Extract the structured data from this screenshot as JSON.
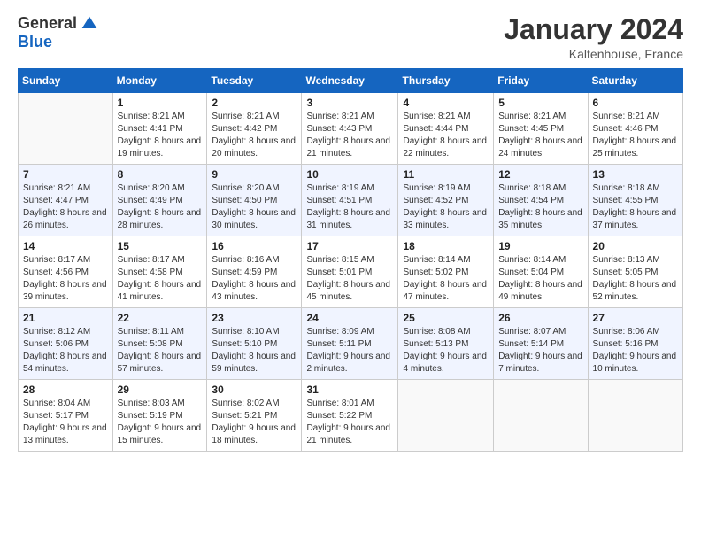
{
  "logo": {
    "general": "General",
    "blue": "Blue"
  },
  "header": {
    "month": "January 2024",
    "location": "Kaltenhouse, France"
  },
  "days_of_week": [
    "Sunday",
    "Monday",
    "Tuesday",
    "Wednesday",
    "Thursday",
    "Friday",
    "Saturday"
  ],
  "weeks": [
    [
      {
        "num": "",
        "sunrise": "",
        "sunset": "",
        "daylight": "",
        "empty": true
      },
      {
        "num": "1",
        "sunrise": "Sunrise: 8:21 AM",
        "sunset": "Sunset: 4:41 PM",
        "daylight": "Daylight: 8 hours and 19 minutes."
      },
      {
        "num": "2",
        "sunrise": "Sunrise: 8:21 AM",
        "sunset": "Sunset: 4:42 PM",
        "daylight": "Daylight: 8 hours and 20 minutes."
      },
      {
        "num": "3",
        "sunrise": "Sunrise: 8:21 AM",
        "sunset": "Sunset: 4:43 PM",
        "daylight": "Daylight: 8 hours and 21 minutes."
      },
      {
        "num": "4",
        "sunrise": "Sunrise: 8:21 AM",
        "sunset": "Sunset: 4:44 PM",
        "daylight": "Daylight: 8 hours and 22 minutes."
      },
      {
        "num": "5",
        "sunrise": "Sunrise: 8:21 AM",
        "sunset": "Sunset: 4:45 PM",
        "daylight": "Daylight: 8 hours and 24 minutes."
      },
      {
        "num": "6",
        "sunrise": "Sunrise: 8:21 AM",
        "sunset": "Sunset: 4:46 PM",
        "daylight": "Daylight: 8 hours and 25 minutes."
      }
    ],
    [
      {
        "num": "7",
        "sunrise": "Sunrise: 8:21 AM",
        "sunset": "Sunset: 4:47 PM",
        "daylight": "Daylight: 8 hours and 26 minutes."
      },
      {
        "num": "8",
        "sunrise": "Sunrise: 8:20 AM",
        "sunset": "Sunset: 4:49 PM",
        "daylight": "Daylight: 8 hours and 28 minutes."
      },
      {
        "num": "9",
        "sunrise": "Sunrise: 8:20 AM",
        "sunset": "Sunset: 4:50 PM",
        "daylight": "Daylight: 8 hours and 30 minutes."
      },
      {
        "num": "10",
        "sunrise": "Sunrise: 8:19 AM",
        "sunset": "Sunset: 4:51 PM",
        "daylight": "Daylight: 8 hours and 31 minutes."
      },
      {
        "num": "11",
        "sunrise": "Sunrise: 8:19 AM",
        "sunset": "Sunset: 4:52 PM",
        "daylight": "Daylight: 8 hours and 33 minutes."
      },
      {
        "num": "12",
        "sunrise": "Sunrise: 8:18 AM",
        "sunset": "Sunset: 4:54 PM",
        "daylight": "Daylight: 8 hours and 35 minutes."
      },
      {
        "num": "13",
        "sunrise": "Sunrise: 8:18 AM",
        "sunset": "Sunset: 4:55 PM",
        "daylight": "Daylight: 8 hours and 37 minutes."
      }
    ],
    [
      {
        "num": "14",
        "sunrise": "Sunrise: 8:17 AM",
        "sunset": "Sunset: 4:56 PM",
        "daylight": "Daylight: 8 hours and 39 minutes."
      },
      {
        "num": "15",
        "sunrise": "Sunrise: 8:17 AM",
        "sunset": "Sunset: 4:58 PM",
        "daylight": "Daylight: 8 hours and 41 minutes."
      },
      {
        "num": "16",
        "sunrise": "Sunrise: 8:16 AM",
        "sunset": "Sunset: 4:59 PM",
        "daylight": "Daylight: 8 hours and 43 minutes."
      },
      {
        "num": "17",
        "sunrise": "Sunrise: 8:15 AM",
        "sunset": "Sunset: 5:01 PM",
        "daylight": "Daylight: 8 hours and 45 minutes."
      },
      {
        "num": "18",
        "sunrise": "Sunrise: 8:14 AM",
        "sunset": "Sunset: 5:02 PM",
        "daylight": "Daylight: 8 hours and 47 minutes."
      },
      {
        "num": "19",
        "sunrise": "Sunrise: 8:14 AM",
        "sunset": "Sunset: 5:04 PM",
        "daylight": "Daylight: 8 hours and 49 minutes."
      },
      {
        "num": "20",
        "sunrise": "Sunrise: 8:13 AM",
        "sunset": "Sunset: 5:05 PM",
        "daylight": "Daylight: 8 hours and 52 minutes."
      }
    ],
    [
      {
        "num": "21",
        "sunrise": "Sunrise: 8:12 AM",
        "sunset": "Sunset: 5:06 PM",
        "daylight": "Daylight: 8 hours and 54 minutes."
      },
      {
        "num": "22",
        "sunrise": "Sunrise: 8:11 AM",
        "sunset": "Sunset: 5:08 PM",
        "daylight": "Daylight: 8 hours and 57 minutes."
      },
      {
        "num": "23",
        "sunrise": "Sunrise: 8:10 AM",
        "sunset": "Sunset: 5:10 PM",
        "daylight": "Daylight: 8 hours and 59 minutes."
      },
      {
        "num": "24",
        "sunrise": "Sunrise: 8:09 AM",
        "sunset": "Sunset: 5:11 PM",
        "daylight": "Daylight: 9 hours and 2 minutes."
      },
      {
        "num": "25",
        "sunrise": "Sunrise: 8:08 AM",
        "sunset": "Sunset: 5:13 PM",
        "daylight": "Daylight: 9 hours and 4 minutes."
      },
      {
        "num": "26",
        "sunrise": "Sunrise: 8:07 AM",
        "sunset": "Sunset: 5:14 PM",
        "daylight": "Daylight: 9 hours and 7 minutes."
      },
      {
        "num": "27",
        "sunrise": "Sunrise: 8:06 AM",
        "sunset": "Sunset: 5:16 PM",
        "daylight": "Daylight: 9 hours and 10 minutes."
      }
    ],
    [
      {
        "num": "28",
        "sunrise": "Sunrise: 8:04 AM",
        "sunset": "Sunset: 5:17 PM",
        "daylight": "Daylight: 9 hours and 13 minutes."
      },
      {
        "num": "29",
        "sunrise": "Sunrise: 8:03 AM",
        "sunset": "Sunset: 5:19 PM",
        "daylight": "Daylight: 9 hours and 15 minutes."
      },
      {
        "num": "30",
        "sunrise": "Sunrise: 8:02 AM",
        "sunset": "Sunset: 5:21 PM",
        "daylight": "Daylight: 9 hours and 18 minutes."
      },
      {
        "num": "31",
        "sunrise": "Sunrise: 8:01 AM",
        "sunset": "Sunset: 5:22 PM",
        "daylight": "Daylight: 9 hours and 21 minutes."
      },
      {
        "num": "",
        "sunrise": "",
        "sunset": "",
        "daylight": "",
        "empty": true
      },
      {
        "num": "",
        "sunrise": "",
        "sunset": "",
        "daylight": "",
        "empty": true
      },
      {
        "num": "",
        "sunrise": "",
        "sunset": "",
        "daylight": "",
        "empty": true
      }
    ]
  ]
}
